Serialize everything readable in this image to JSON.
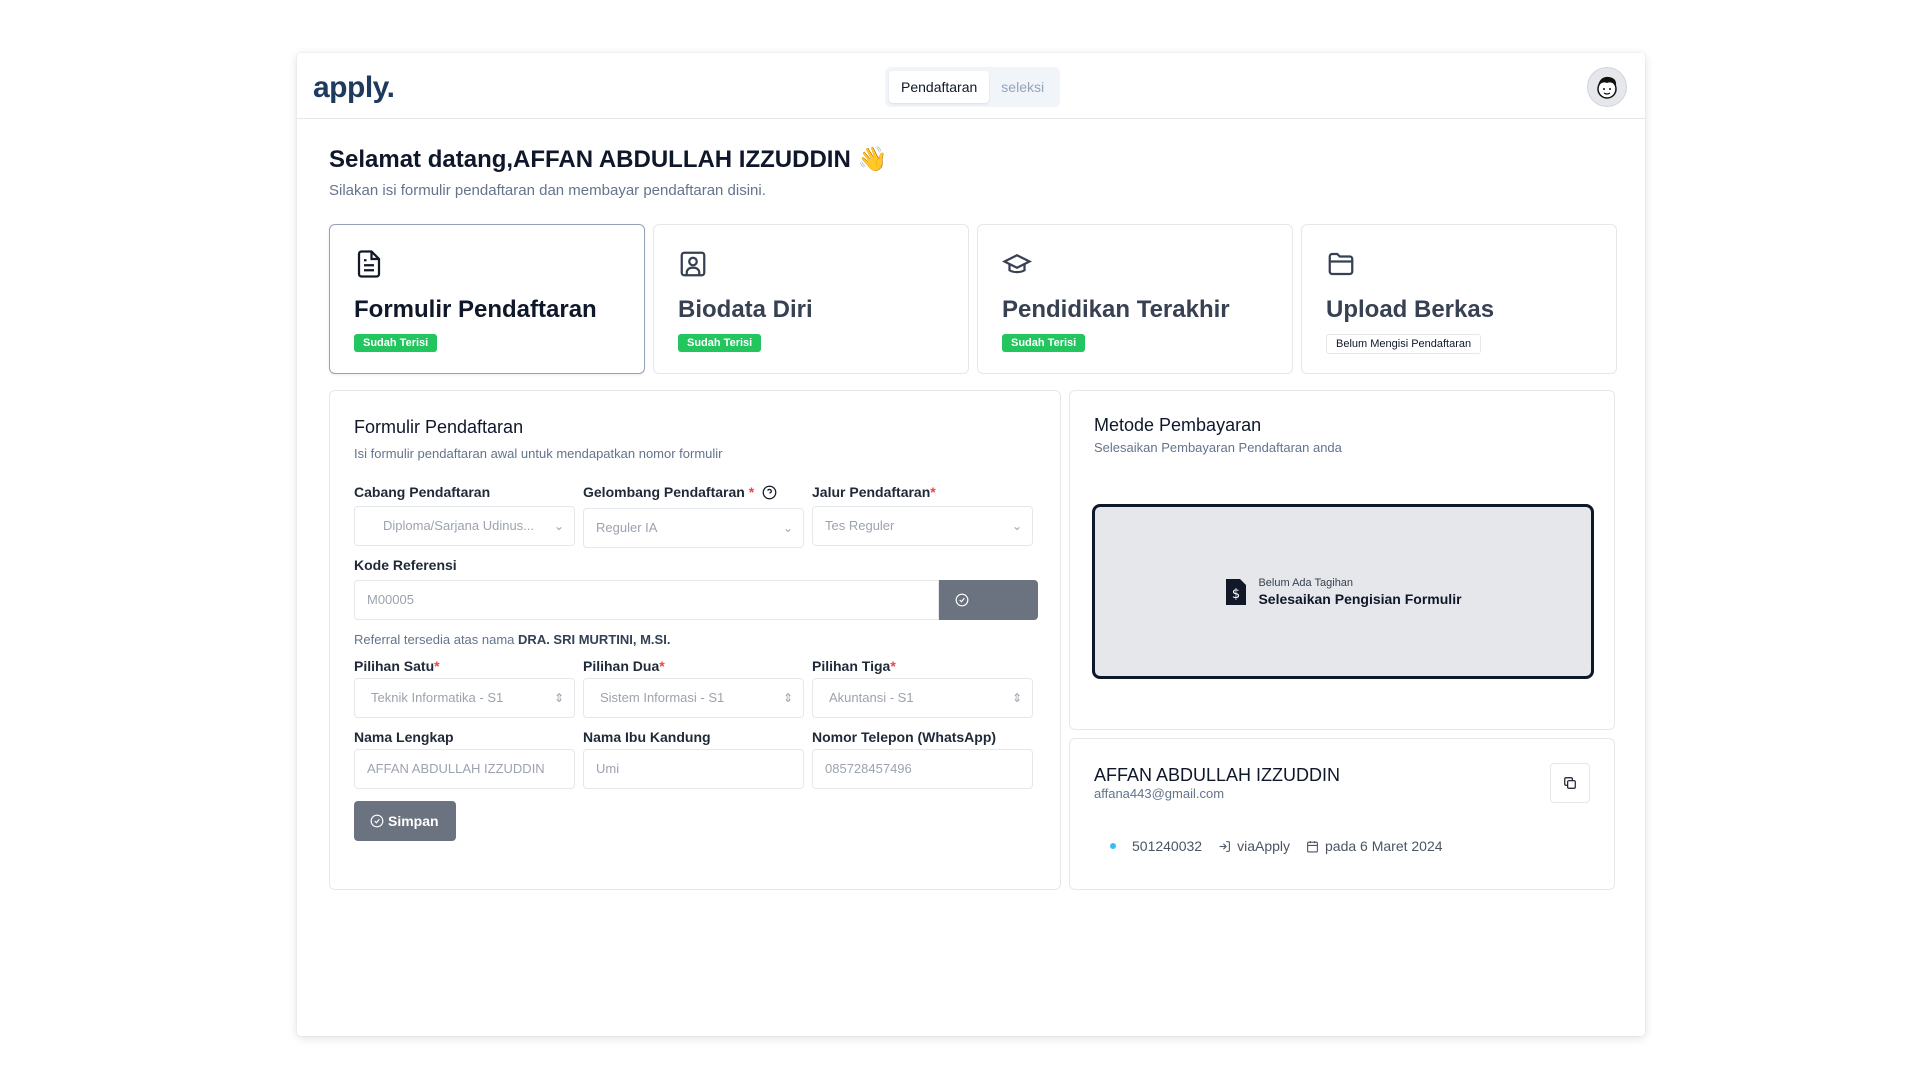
{
  "app": {
    "logo": "apply."
  },
  "nav": {
    "tabs": [
      {
        "label": "Pendaftaran",
        "active": true
      },
      {
        "label": "seleksi",
        "active": false
      }
    ]
  },
  "greeting": {
    "title": "Selamat datang,AFFAN ABDULLAH IZZUDDIN",
    "emoji": "👋",
    "subtitle": "Silakan isi formulir pendaftaran dan membayar pendaftaran disini."
  },
  "steps": [
    {
      "title": "Formulir Pendaftaran",
      "status": "Sudah Terisi",
      "icon": "document-icon"
    },
    {
      "title": "Biodata Diri",
      "status": "Sudah Terisi",
      "icon": "profile-card-icon"
    },
    {
      "title": "Pendidikan Terakhir",
      "status": "Sudah Terisi",
      "icon": "graduation-cap-icon"
    },
    {
      "title": "Upload Berkas",
      "status": "Belum Mengisi Pendaftaran",
      "icon": "folder-icon"
    }
  ],
  "form": {
    "title": "Formulir Pendaftaran",
    "subtitle": "Isi formulir pendaftaran awal untuk mendapatkan nomor formulir",
    "cabang_label": "Cabang Pendaftaran",
    "cabang_value": "Diploma/Sarjana Udinus...",
    "gelombang_label": "Gelombang Pendaftaran",
    "gelombang_value": "Reguler IA",
    "jalur_label": "Jalur Pendaftaran",
    "jalur_value": "Tes Reguler",
    "kode_label": "Kode Referensi",
    "kode_value": "M00005",
    "periksa_label": "Periksa",
    "referral_note": "Referral tersedia atas nama",
    "referral_name": "DRA. SRI MURTINI, M.SI.",
    "pilihan1_label": "Pilihan Satu",
    "pilihan1_value": "Teknik Informatika - S1",
    "pilihan2_label": "Pilihan Dua",
    "pilihan2_value": "Sistem Informasi - S1",
    "pilihan3_label": "Pilihan Tiga",
    "pilihan3_value": "Akuntansi - S1",
    "nama_label": "Nama Lengkap",
    "nama_value": "AFFAN ABDULLAH IZZUDDIN",
    "ibu_label": "Nama Ibu Kandung",
    "ibu_value": "Umi",
    "telp_label": "Nomor Telepon (WhatsApp)",
    "telp_value": "085728457496",
    "simpan_label": "Simpan",
    "required_mark": "*"
  },
  "payment": {
    "title": "Metode Pembayaran",
    "subtitle": "Selesaikan Pembayaran Pendaftaran anda",
    "bill_status": "Belum Ada Tagihan",
    "bill_action": "Selesaikan Pengisian Formulir"
  },
  "user": {
    "name": "AFFAN ABDULLAH IZZUDDIN",
    "email": "affana443@gmail.com",
    "form_number": "501240032",
    "via": "viaApply",
    "date": "pada 6 Maret 2024"
  },
  "colors": {
    "brand": "#1e3a5f",
    "success": "#22c55e",
    "button_disabled": "#6b7280",
    "dot": "#38bdf8"
  }
}
